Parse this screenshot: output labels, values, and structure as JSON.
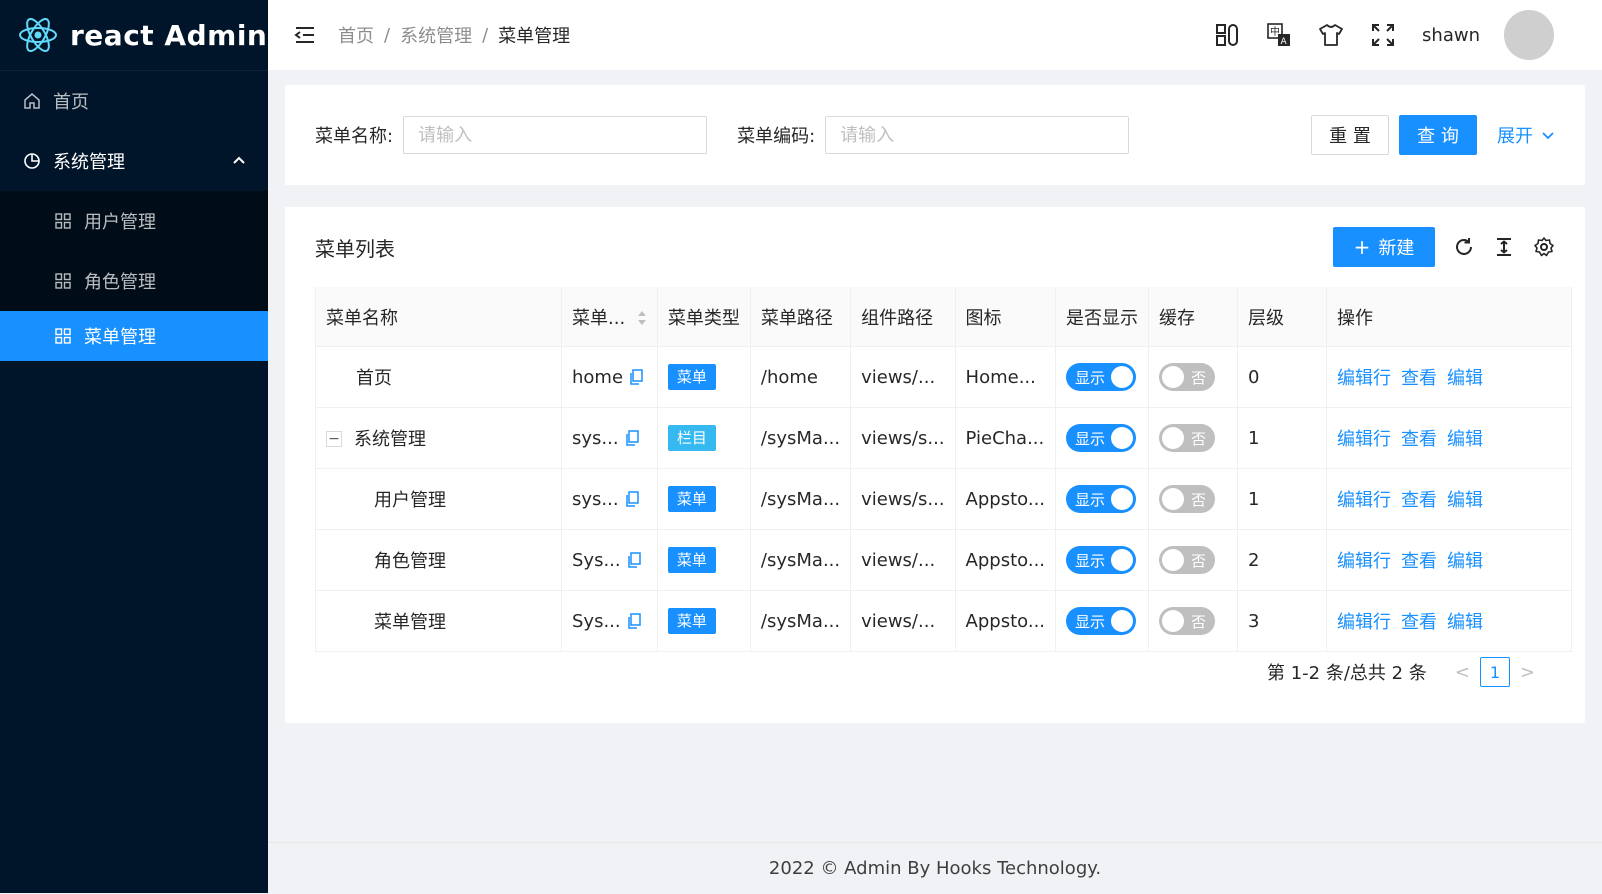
{
  "app": {
    "title": "react Admin"
  },
  "sidebar": {
    "items": [
      {
        "label": "首页",
        "icon": "home-icon"
      },
      {
        "label": "系统管理",
        "icon": "pie-chart-icon",
        "open": true,
        "children": [
          {
            "label": "用户管理",
            "icon": "appstore-icon"
          },
          {
            "label": "角色管理",
            "icon": "appstore-icon"
          },
          {
            "label": "菜单管理",
            "icon": "appstore-icon",
            "active": true
          }
        ]
      }
    ]
  },
  "header": {
    "breadcrumb": [
      "首页",
      "系统管理",
      "菜单管理"
    ],
    "separator": "/",
    "username": "shawn"
  },
  "search": {
    "fields": [
      {
        "label": "菜单名称:",
        "placeholder": "请输入",
        "value": ""
      },
      {
        "label": "菜单编码:",
        "placeholder": "请输入",
        "value": ""
      }
    ],
    "reset_label": "重 置",
    "query_label": "查 询",
    "expand_label": "展开"
  },
  "table": {
    "title": "菜单列表",
    "new_label": "新建",
    "columns": [
      "菜单名称",
      "菜单...",
      "菜单类型",
      "菜单路径",
      "组件路径",
      "图标",
      "是否显示",
      "缓存",
      "层级",
      "操作"
    ],
    "rows": [
      {
        "name": "首页",
        "code": "home",
        "type": "菜单",
        "path": "/home",
        "component": "views/...",
        "icon": "Home...",
        "show": "显示",
        "cache": "否",
        "level": "0",
        "ops": [
          "编辑行",
          "查看",
          "编辑"
        ]
      },
      {
        "name": "系统管理",
        "toggle": "−",
        "code": "sys...",
        "type": "栏目",
        "path": "/sysMa...",
        "component": "views/s...",
        "icon": "PieCha...",
        "show": "显示",
        "cache": "否",
        "level": "1",
        "ops": [
          "编辑行",
          "查看",
          "编辑"
        ]
      },
      {
        "name": "用户管理",
        "code": "sys...",
        "type": "菜单",
        "path": "/sysMa...",
        "component": "views/s...",
        "icon": "Appsto...",
        "show": "显示",
        "cache": "否",
        "level": "1",
        "ops": [
          "编辑行",
          "查看",
          "编辑"
        ]
      },
      {
        "name": "角色管理",
        "code": "Sys...",
        "type": "菜单",
        "path": "/sysMa...",
        "component": "views/...",
        "icon": "Appsto...",
        "show": "显示",
        "cache": "否",
        "level": "2",
        "ops": [
          "编辑行",
          "查看",
          "编辑"
        ]
      },
      {
        "name": "菜单管理",
        "code": "Sys...",
        "type": "菜单",
        "path": "/sysMa...",
        "component": "views/...",
        "icon": "Appsto...",
        "show": "显示",
        "cache": "否",
        "level": "3",
        "ops": [
          "编辑行",
          "查看",
          "编辑"
        ]
      }
    ]
  },
  "pagination": {
    "total_text": "第 1-2 条/总共 2 条",
    "current": "1",
    "prev": "<",
    "next": ">"
  },
  "footer": {
    "text": "2022 © Admin By Hooks Technology."
  },
  "colors": {
    "primary": "#1890ff",
    "sidebar": "#001529",
    "tag_menu": "#1890ff",
    "tag_column": "#36b8f0"
  }
}
